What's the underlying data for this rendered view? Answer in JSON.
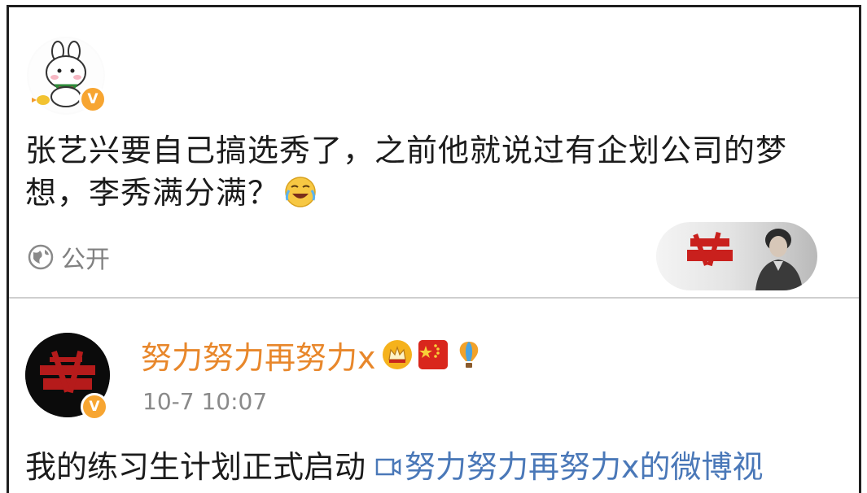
{
  "post": {
    "text": "张艺兴要自己搞选秀了，之前他就说过有企划公司的梦想，李秀满分满？",
    "emoji": "laugh-cry-emoji",
    "visibility_label": "公开",
    "verified_badge": "V"
  },
  "retweet": {
    "username": "努力努力再努力x",
    "username_badges": [
      "crown-badge",
      "china-flag-badge",
      "balloon-badge"
    ],
    "timestamp": "10-7 10:07",
    "text": "我的练习生计划正式启动",
    "video_link": "努力努力再努力x的微博视",
    "verified_badge": "V"
  },
  "colors": {
    "username": "#e8872b",
    "link": "#4a78b8",
    "meta": "#8a8a8a",
    "verified": "#f7a531",
    "border": "#1f1f1f"
  }
}
